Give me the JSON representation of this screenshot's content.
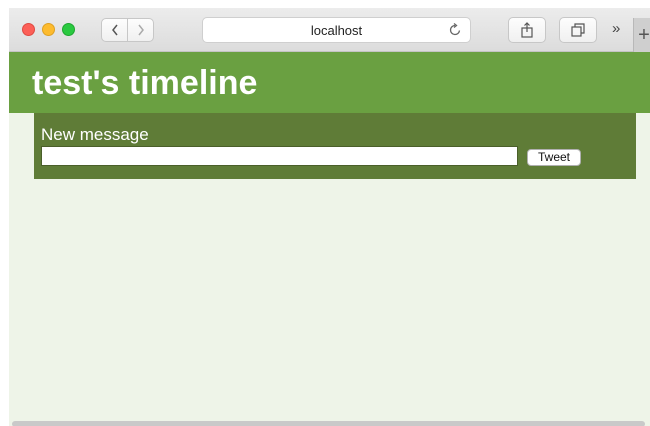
{
  "browser": {
    "url": "localhost",
    "more_label": "»",
    "new_tab_label": "+"
  },
  "page": {
    "title": "test's timeline"
  },
  "composer": {
    "label": "New message",
    "input_value": "",
    "input_placeholder": "",
    "submit_label": "Tweet"
  },
  "colors": {
    "header": "#6aa041",
    "panel": "#5f7c37",
    "background": "#eef4e8"
  }
}
